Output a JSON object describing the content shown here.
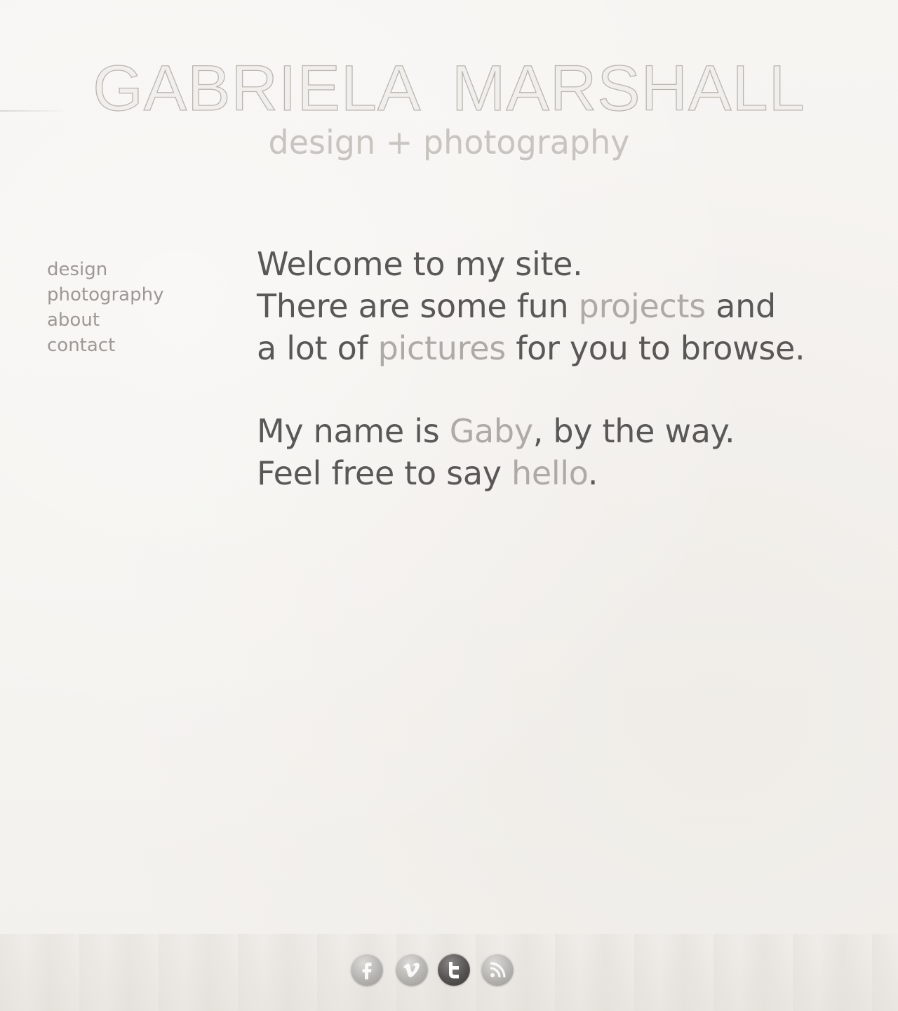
{
  "header": {
    "title": "GABRIELA MARSHALL",
    "tagline": "design + photography"
  },
  "nav": {
    "items": [
      {
        "label": "design"
      },
      {
        "label": "photography"
      },
      {
        "label": "about"
      },
      {
        "label": "contact"
      }
    ]
  },
  "intro": {
    "line1": "Welcome to my site.",
    "line2_pre": "There are some fun ",
    "line2_link": "projects",
    "line2_post": " and",
    "line3_pre": "a lot of ",
    "line3_link": "pictures",
    "line3_post": " for you to browse.",
    "line4_pre": "My name is ",
    "line4_link": "Gaby",
    "line4_post": ", by the way.",
    "line5_pre": "Feel free to say ",
    "line5_link": "hello",
    "line5_post": "."
  },
  "social": [
    {
      "icon": "facebook-icon"
    },
    {
      "icon": "vimeo-icon"
    },
    {
      "icon": "twitter-icon"
    },
    {
      "icon": "rss-icon"
    }
  ],
  "colors": {
    "background": "#f5f3f0",
    "body_text": "#5a5856",
    "link_text": "#aeaba7",
    "nav_text": "#9c9995"
  }
}
